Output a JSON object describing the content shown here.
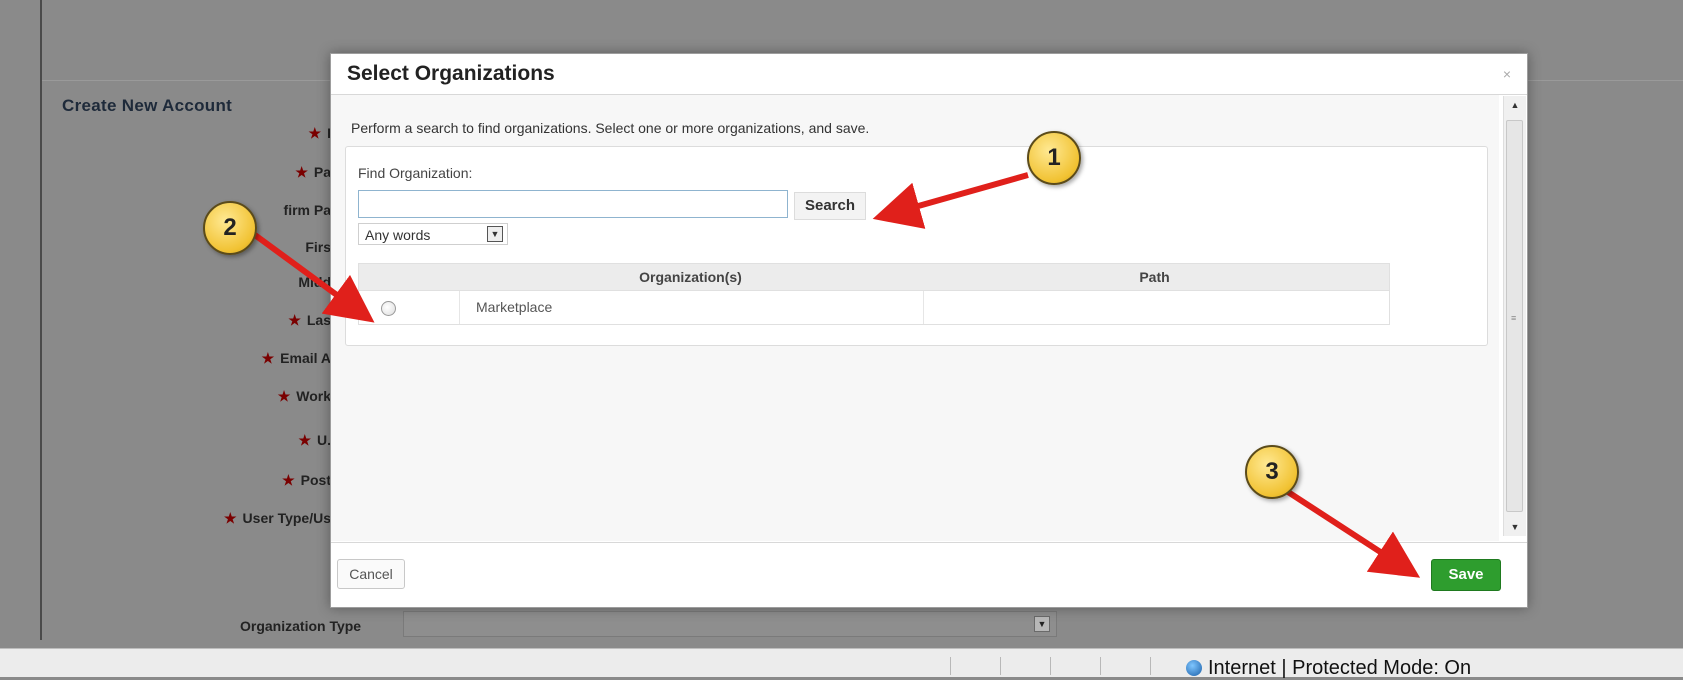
{
  "background": {
    "form_title": "Create New Account",
    "fields": [
      {
        "label": "I",
        "required": true
      },
      {
        "label": "Pa",
        "required": true
      },
      {
        "label": "firm Pa",
        "required": false
      },
      {
        "label": "Firs",
        "required": false
      },
      {
        "label": "Midd",
        "required": false
      },
      {
        "label": "Las",
        "required": true
      },
      {
        "label": "Email A",
        "required": true
      },
      {
        "label": "Work",
        "required": true
      },
      {
        "label": "U.",
        "required": true
      },
      {
        "label": "Post",
        "required": true
      },
      {
        "label": "User Type/Us",
        "required": true
      }
    ],
    "organization_type_label": "Organization Type",
    "status_bar_text": "Internet | Protected Mode: On"
  },
  "modal": {
    "title": "Select Organizations",
    "close_glyph": "×",
    "instructions": "Perform a search to find organizations. Select one or more organizations, and save.",
    "find_label": "Find Organization:",
    "search_value": "",
    "search_button": "Search",
    "match_mode": "Any words",
    "table": {
      "columns": [
        "Organization(s)",
        "Path"
      ],
      "rows": [
        {
          "organization": "Marketplace",
          "path": "",
          "selected": false
        }
      ]
    },
    "cancel_button": "Cancel",
    "save_button": "Save"
  },
  "annotations": {
    "callout_1": "1",
    "callout_2": "2",
    "callout_3": "3"
  },
  "colors": {
    "save_green": "#2e9d2e",
    "callout_yellow": "#f1c232",
    "arrow_red": "#e0201b",
    "required_star": "#7a0000"
  }
}
